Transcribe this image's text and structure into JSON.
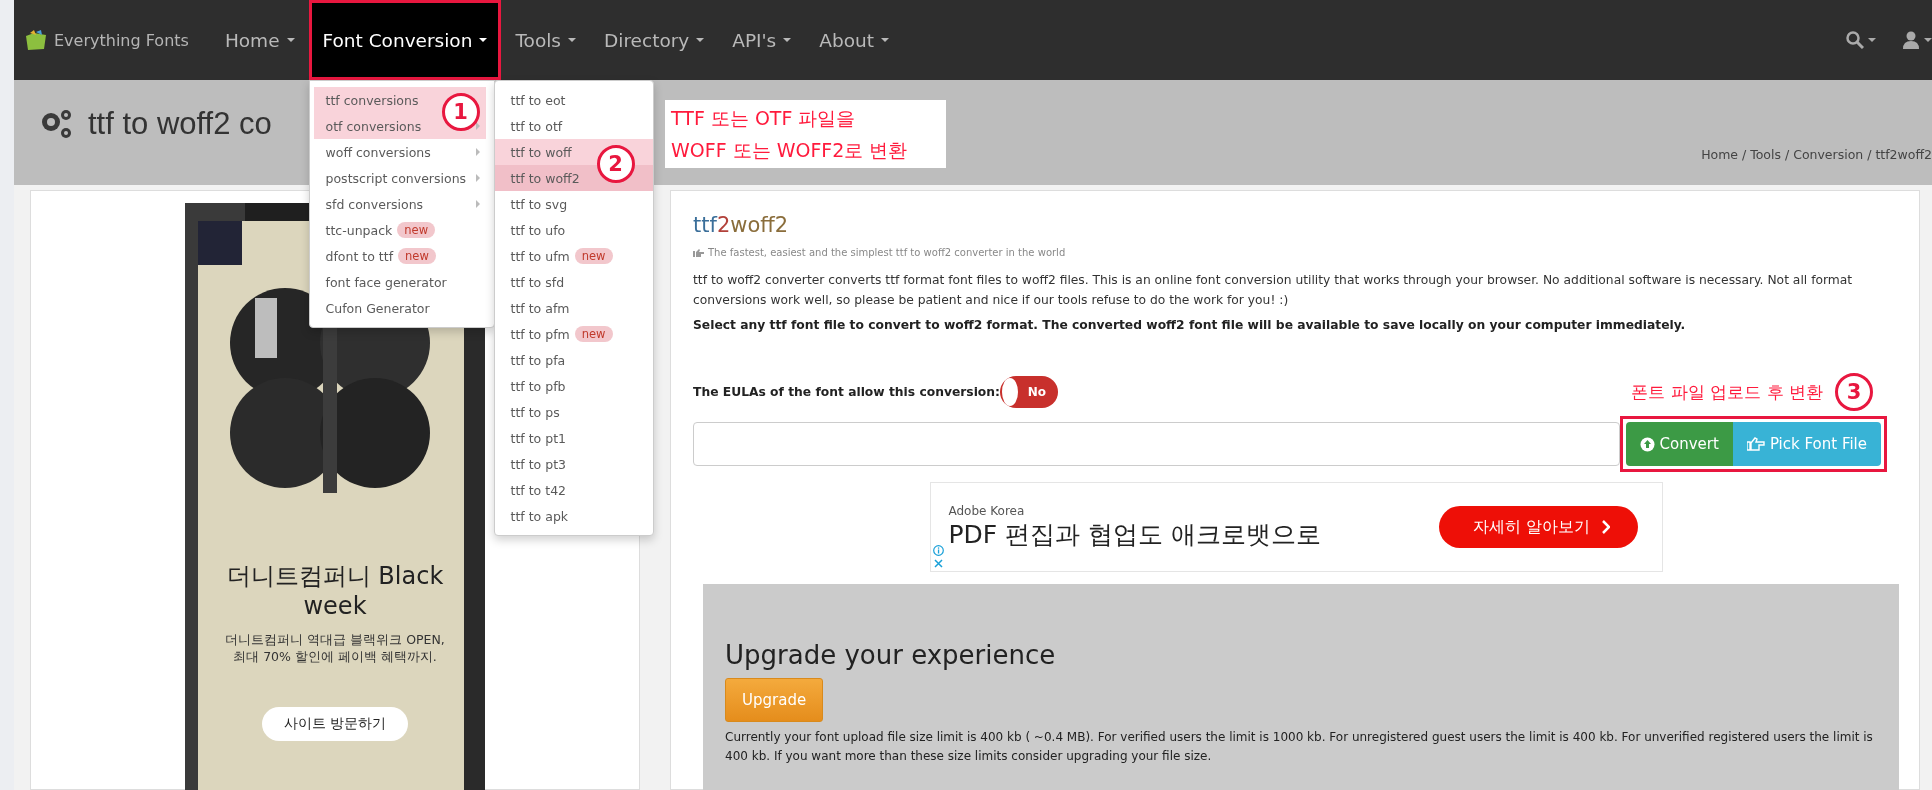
{
  "navbar": {
    "brand": "Everything Fonts",
    "items": [
      {
        "label": "Home",
        "selected": false,
        "outlined": false
      },
      {
        "label": "Font Conversion",
        "selected": true,
        "outlined": true
      },
      {
        "label": "Tools",
        "selected": false,
        "outlined": false
      },
      {
        "label": "Directory",
        "selected": false,
        "outlined": false
      },
      {
        "label": "API's",
        "selected": false,
        "outlined": false
      },
      {
        "label": "About",
        "selected": false,
        "outlined": false
      }
    ]
  },
  "menu": {
    "items": [
      {
        "label": "ttf conversions",
        "highlighted": true,
        "submenu": false,
        "marker": "1"
      },
      {
        "label": "otf conversions",
        "highlighted": true,
        "submenu": true
      },
      {
        "label": "woff conversions",
        "highlighted": false,
        "submenu": true
      },
      {
        "label": "postscript conversions",
        "highlighted": false,
        "submenu": true
      },
      {
        "label": "sfd conversions",
        "highlighted": false,
        "submenu": true
      },
      {
        "label": "ttc-unpack",
        "highlighted": false,
        "submenu": false,
        "badge": "new"
      },
      {
        "label": "dfont to ttf",
        "highlighted": false,
        "submenu": false,
        "badge": "new"
      },
      {
        "label": "font face generator",
        "highlighted": false,
        "submenu": false
      },
      {
        "label": "Cufon Generator",
        "highlighted": false,
        "submenu": false
      }
    ]
  },
  "submenu": {
    "items": [
      {
        "label": "ttf to eot",
        "highlighted": false,
        "selected": false
      },
      {
        "label": "ttf to otf",
        "highlighted": false,
        "selected": false
      },
      {
        "label": "ttf to woff",
        "highlighted": true,
        "selected": false,
        "marker": "2"
      },
      {
        "label": "ttf to woff2",
        "highlighted": true,
        "selected": true
      },
      {
        "label": "ttf to svg",
        "highlighted": false,
        "selected": false
      },
      {
        "label": "ttf to ufo",
        "highlighted": false,
        "selected": false
      },
      {
        "label": "ttf to ufm",
        "highlighted": false,
        "selected": false,
        "badge": "new"
      },
      {
        "label": "ttf to sfd",
        "highlighted": false,
        "selected": false
      },
      {
        "label": "ttf to afm",
        "highlighted": false,
        "selected": false
      },
      {
        "label": "ttf to pfm",
        "highlighted": false,
        "selected": false,
        "badge": "new"
      },
      {
        "label": "ttf to pfa",
        "highlighted": false,
        "selected": false
      },
      {
        "label": "ttf to pfb",
        "highlighted": false,
        "selected": false
      },
      {
        "label": "ttf to ps",
        "highlighted": false,
        "selected": false
      },
      {
        "label": "ttf to pt1",
        "highlighted": false,
        "selected": false
      },
      {
        "label": "ttf to pt3",
        "highlighted": false,
        "selected": false
      },
      {
        "label": "ttf to t42",
        "highlighted": false,
        "selected": false
      },
      {
        "label": "ttf to apk",
        "highlighted": false,
        "selected": false
      }
    ]
  },
  "header": {
    "title": "ttf to woff2 co",
    "note_lines": [
      "TTF 또는 OTF 파일을",
      "WOFF 또는 WOFF2로 변환"
    ],
    "breadcrumb": "Home / Tools / Conversion / ttf2woff2"
  },
  "side_ad": {
    "kind": "picture",
    "headline": "더니트컴퍼니 Black week",
    "text_lines": [
      "더니트컴퍼니 역대급 블랙위크 OPEN,",
      "최대 70% 할인에 페이백 혜택까지."
    ],
    "button": "사이트 방문하기"
  },
  "converter": {
    "title_parts": [
      "ttf",
      "2",
      "woff2"
    ],
    "tagline": "The fastest, easiest and the simplest ttf to woff2 converter in the world",
    "description": "ttf to woff2 converter converts ttf format font files to woff2 files. This is an online font conversion utility that works through your browser. No additional software is necessary. Not all format conversions work well, so please be patient and nice if our tools refuse to do the work for you! :)",
    "instruction": "Select any ttf font file to convert to woff2 format. The converted woff2 font file will be available to save locally on your computer immediately.",
    "eula_label": "The EULAs of the font allow this conversion:",
    "eula_on": false,
    "eula_text": "No",
    "callout": "폰트 파일 업로드 후 변환",
    "callout_marker": "3",
    "buttons_outlined": true,
    "convert_button": "Convert",
    "pick_button": "Pick Font File"
  },
  "banner_ad": {
    "advertiser": "Adobe Korea",
    "headline": "PDF 편집과 협업도 애크로뱃으로",
    "button": "자세히 알아보기"
  },
  "upgrade": {
    "title": "Upgrade your experience",
    "button": "Upgrade",
    "text": "Currently your font upload file size limit is 400 kb ( ~0.4 MB). For verified users the limit is 1000 kb. For unregistered guest users the limit is 400 kb. For unverified registered users the limit is 400 kb. If you want more than these size limits consider upgrading your file size."
  }
}
